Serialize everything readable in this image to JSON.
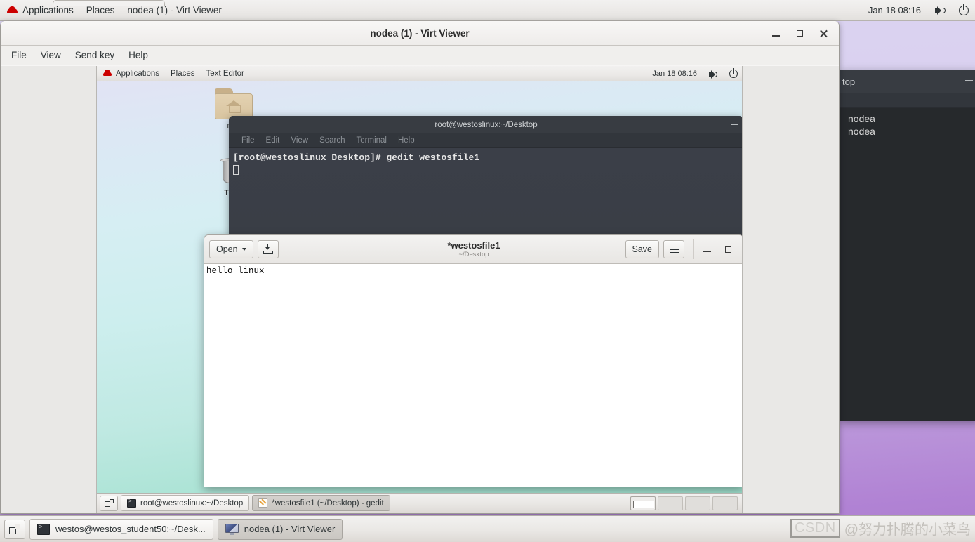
{
  "host": {
    "panel": {
      "logo_icon": "redhat-logo-icon",
      "applications_label": "Applications",
      "places_label": "Places",
      "window_title_label": "nodea (1) - Virt Viewer",
      "clock": "Jan 18  08:16",
      "volume_icon": "volume-icon",
      "power_icon": "power-icon"
    },
    "taskbar": {
      "show_desktop_icon": "show-desktop-icon",
      "tasks": [
        {
          "label": "westos@westos_student50:~/Desk...",
          "icon": "terminal-icon",
          "active": false
        },
        {
          "label": "nodea (1) - Virt Viewer",
          "icon": "virt-viewer-icon",
          "active": true
        }
      ]
    },
    "watermark": {
      "badge": "CSDN",
      "text": "@努力扑腾的小菜鸟"
    }
  },
  "virt_viewer": {
    "title": "nodea (1) - Virt Viewer",
    "menus": [
      "File",
      "View",
      "Send key",
      "Help"
    ],
    "window_buttons": {
      "minimize": "minimize-icon",
      "maximize": "maximize-icon",
      "close": "close-icon"
    }
  },
  "guest": {
    "panel": {
      "logo_icon": "redhat-logo-icon",
      "applications_label": "Applications",
      "places_label": "Places",
      "active_app_label": "Text Editor",
      "clock": "Jan 18  08:16",
      "volume_icon": "volume-icon",
      "power_icon": "power-icon"
    },
    "desktop_icons": [
      {
        "label": "root",
        "icon": "home-folder-icon"
      },
      {
        "label": "Trash",
        "icon": "trash-icon"
      }
    ],
    "terminal": {
      "title": "root@westoslinux:~/Desktop",
      "menus": [
        "File",
        "Edit",
        "View",
        "Search",
        "Terminal",
        "Help"
      ],
      "lines": [
        "[root@westoslinux Desktop]# gedit westosfile1"
      ],
      "minimize_icon": "minimize-icon"
    },
    "gedit": {
      "open_label": "Open",
      "open_caret_icon": "chevron-down-icon",
      "save_as_icon": "save-as-icon",
      "doc_title": "*westosfile1",
      "doc_path": "~/Desktop",
      "save_label": "Save",
      "menu_icon": "hamburger-menu-icon",
      "minimize_icon": "minimize-icon",
      "maximize_icon": "maximize-icon",
      "document_lines": [
        "hello linux"
      ]
    },
    "taskbar": {
      "show_desktop_icon": "show-desktop-icon",
      "tasks": [
        {
          "label": "root@westoslinux:~/Desktop",
          "icon": "terminal-icon",
          "active": false
        },
        {
          "label": "*westosfile1 (~/Desktop) - gedit",
          "icon": "gedit-icon",
          "active": true
        }
      ],
      "workspaces": [
        {
          "name": "workspace-1",
          "active": true
        },
        {
          "name": "workspace-2",
          "active": false
        },
        {
          "name": "workspace-3",
          "active": false
        },
        {
          "name": "workspace-4",
          "active": false
        }
      ]
    }
  },
  "background_terminal": {
    "title_fragment": "top",
    "lines": [
      "nodea",
      "nodea"
    ],
    "minimize_icon": "minimize-icon"
  },
  "colors": {
    "host_wallpaper_top": "#dcd5f2",
    "host_wallpaper_bottom": "#ab7ccf",
    "guest_wallpaper_top": "#e3e2f4",
    "guest_wallpaper_bottom": "#9bdcc9",
    "terminal_bg": "#383c42",
    "terminal_text": "#e6e6e6",
    "panel_bg": "#eceae8",
    "accent_redhat": "#cc0000"
  }
}
